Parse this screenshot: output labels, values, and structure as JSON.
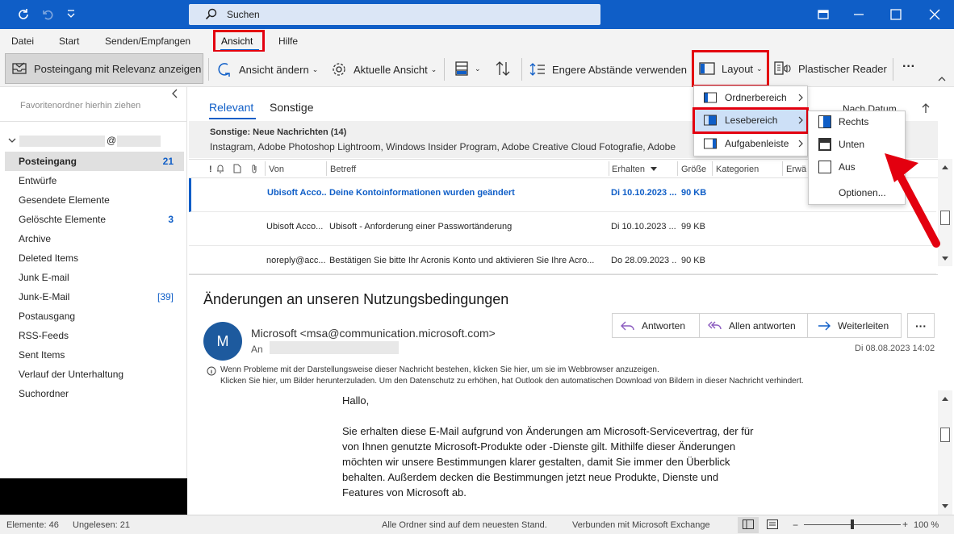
{
  "titlebar": {
    "search_label": "Suchen"
  },
  "menu": {
    "items": [
      "Datei",
      "Start",
      "Senden/Empfangen",
      "Ansicht",
      "Hilfe"
    ]
  },
  "ribbon": {
    "relevanz": "Posteingang mit Relevanz anzeigen",
    "ansicht_aendern": "Ansicht ändern",
    "aktuelle_ansicht": "Aktuelle Ansicht",
    "engere_abstaende": "Engere Abstände verwenden",
    "layout": "Layout",
    "plastischer_reader": "Plastischer Reader",
    "more": "···"
  },
  "nav": {
    "favorites": "Favoritenordner hierhin ziehen",
    "account_at": "@",
    "folders": [
      {
        "name": "Posteingang",
        "count": "21"
      },
      {
        "name": "Entwürfe",
        "count": ""
      },
      {
        "name": "Gesendete Elemente",
        "count": ""
      },
      {
        "name": "Gelöschte Elemente",
        "count": "3"
      },
      {
        "name": "Archive",
        "count": ""
      },
      {
        "name": "Deleted Items",
        "count": ""
      },
      {
        "name": "Junk E-mail",
        "count": ""
      },
      {
        "name": "Junk-E-Mail",
        "count": "[39]"
      },
      {
        "name": "Postausgang",
        "count": ""
      },
      {
        "name": "RSS-Feeds",
        "count": ""
      },
      {
        "name": "Sent Items",
        "count": ""
      },
      {
        "name": "Verlauf der Unterhaltung",
        "count": ""
      },
      {
        "name": "Suchordner",
        "count": ""
      }
    ]
  },
  "list": {
    "tabs": [
      "Relevant",
      "Sonstige"
    ],
    "sort": "Nach Datum",
    "sonstige_title": "Sonstige: Neue Nachrichten (14)",
    "sonstige_senders": "Instagram, Adobe Photoshop Lightroom, Windows Insider Program, Adobe Creative Cloud Fotografie, Adobe",
    "columns": [
      "!",
      "Von",
      "Betreff",
      "Erhalten",
      "Größe",
      "Kategorien",
      "Erwä"
    ],
    "rows": [
      {
        "from": "Ubisoft Acco...",
        "subject": "Deine Kontoinformationen wurden geändert",
        "received": "Di 10.10.2023 ...",
        "size": "90 KB",
        "unread": true
      },
      {
        "from": "Ubisoft Acco...",
        "subject": "Ubisoft - Anforderung einer Passwortänderung",
        "received": "Di 10.10.2023 ...",
        "size": "99 KB",
        "unread": false
      },
      {
        "from": "noreply@acc...",
        "subject": "Bestätigen Sie bitte Ihr Acronis Konto und aktivieren Sie Ihre Acro...",
        "received": "Do 28.09.2023 ...",
        "size": "90 KB",
        "unread": false
      }
    ]
  },
  "layout_menu": {
    "items": [
      "Ordnerbereich",
      "Lesebereich",
      "Aufgabenleiste"
    ]
  },
  "lese_menu": {
    "items": [
      "Rechts",
      "Unten",
      "Aus",
      "Optionen..."
    ]
  },
  "reading": {
    "subject": "Änderungen an unseren Nutzungsbedingungen",
    "avatar_letter": "M",
    "sender": "Microsoft <msa@communication.microsoft.com>",
    "to_label": "An",
    "date": "Di 08.08.2023 14:02",
    "reply": "Antworten",
    "reply_all": "Allen antworten",
    "forward": "Weiterleiten",
    "info_line1": "Wenn Probleme mit der Darstellungsweise dieser Nachricht bestehen, klicken Sie hier, um sie im Webbrowser anzuzeigen.",
    "info_line2": "Klicken Sie hier, um Bilder herunterzuladen. Um den Datenschutz zu erhöhen, hat Outlook den automatischen Download von Bildern in dieser Nachricht verhindert.",
    "greeting": "Hallo,",
    "body_lines": [
      "Sie erhalten diese E-Mail aufgrund von Änderungen am Microsoft-Servicevertrag, der für",
      "von Ihnen genutzte Microsoft-Produkte oder -Dienste gilt. Mithilfe dieser Änderungen",
      "möchten wir unsere Bestimmungen klarer gestalten, damit Sie immer den Überblick",
      "behalten. Außerdem decken die Bestimmungen jetzt neue Produkte, Dienste und",
      "Features von Microsoft ab."
    ]
  },
  "status": {
    "elements": "Elemente: 46",
    "unread": "Ungelesen: 21",
    "uptodate": "Alle Ordner sind auf dem neuesten Stand.",
    "connected": "Verbunden mit Microsoft Exchange",
    "zoom": "100 %"
  },
  "colors": {
    "accent": "#0f5ec7",
    "highlight": "#e3000f",
    "titlebar": "#0f5ec7"
  }
}
